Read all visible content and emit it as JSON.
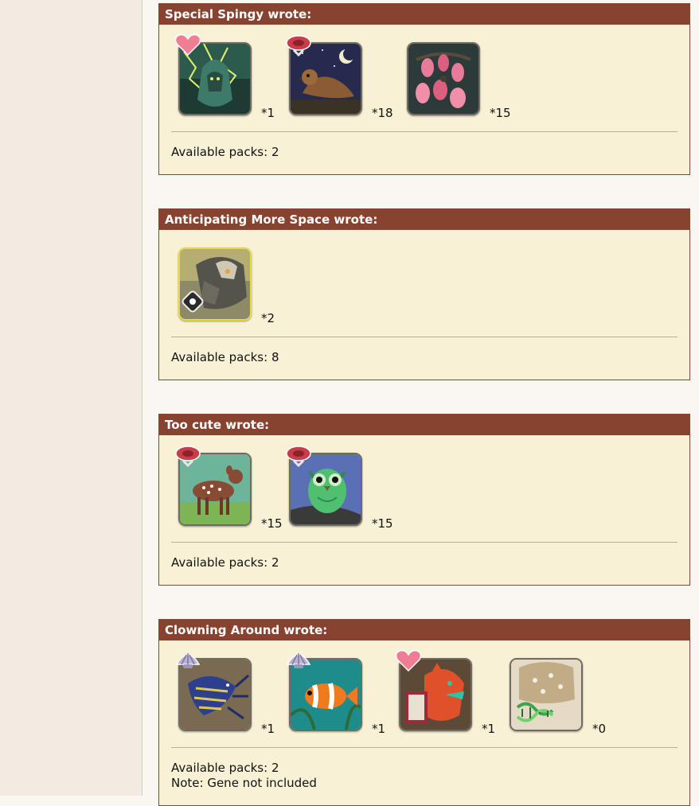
{
  "posts": [
    {
      "header": "Special Spingy wrote:",
      "items": [
        {
          "count": "*1",
          "badge": "heart-icon",
          "subject": "storm-wraith"
        },
        {
          "count": "*18",
          "badge": "meat-icon",
          "subject": "night-bird"
        },
        {
          "count": "*15",
          "badge": "",
          "subject": "pink-eggs"
        }
      ],
      "footer": [
        "Available packs: 2"
      ]
    },
    {
      "header": "Anticipating More Space wrote:",
      "items": [
        {
          "count": "*2",
          "badge": "",
          "subject": "stone-beast"
        }
      ],
      "footer": [
        "Available packs: 8"
      ]
    },
    {
      "header": "Too cute wrote:",
      "items": [
        {
          "count": "*15",
          "badge": "meat-icon",
          "subject": "fawn"
        },
        {
          "count": "*15",
          "badge": "meat-icon",
          "subject": "green-owl"
        }
      ],
      "footer": [
        "Available packs: 2"
      ]
    },
    {
      "header": "Clowning Around wrote:",
      "items": [
        {
          "count": "*1",
          "badge": "shell-icon",
          "subject": "blue-shrimp"
        },
        {
          "count": "*1",
          "badge": "shell-icon",
          "subject": "clownfish"
        },
        {
          "count": "*1",
          "badge": "heart-icon",
          "subject": "orange-dragon"
        },
        {
          "count": "*0",
          "badge": "",
          "subject": "gene-scroll"
        }
      ],
      "footer": [
        "Available packs: 2",
        "Note: Gene not included"
      ]
    }
  ],
  "colors": {
    "header_bg": "#87432f",
    "post_bg": "#f8f1d5",
    "page_bg": "#faf7f2",
    "sidebar_bg": "#f1ebe2"
  }
}
